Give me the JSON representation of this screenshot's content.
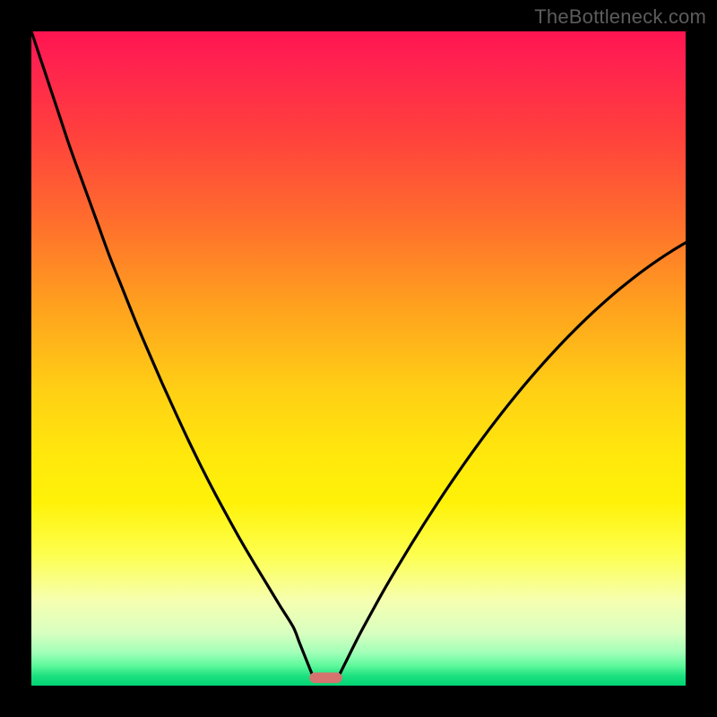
{
  "watermark": "TheBottleneck.com",
  "chart_data": {
    "type": "line",
    "title": "",
    "xlabel": "",
    "ylabel": "",
    "xlim": [
      0,
      100
    ],
    "ylim": [
      0,
      100
    ],
    "gradient_stops": [
      {
        "pct": 0,
        "color": "#ff1450"
      },
      {
        "pct": 4,
        "color": "#ff2050"
      },
      {
        "pct": 15,
        "color": "#ff3e3e"
      },
      {
        "pct": 28,
        "color": "#ff6a2e"
      },
      {
        "pct": 42,
        "color": "#ffa11e"
      },
      {
        "pct": 55,
        "color": "#ffd014"
      },
      {
        "pct": 65,
        "color": "#ffe80c"
      },
      {
        "pct": 72,
        "color": "#fff208"
      },
      {
        "pct": 80,
        "color": "#fdff4f"
      },
      {
        "pct": 87,
        "color": "#f6ffb0"
      },
      {
        "pct": 92,
        "color": "#d8ffc0"
      },
      {
        "pct": 95,
        "color": "#a0ffb8"
      },
      {
        "pct": 97,
        "color": "#5cf89a"
      },
      {
        "pct": 98.5,
        "color": "#1de080"
      },
      {
        "pct": 100,
        "color": "#00d474"
      }
    ],
    "series": [
      {
        "name": "left-branch",
        "x": [
          0,
          2,
          4,
          6,
          8,
          10,
          12,
          14,
          16,
          18,
          20,
          22,
          24,
          26,
          28,
          30,
          32,
          34,
          36,
          38,
          40,
          41,
          42,
          43
        ],
        "y": [
          100,
          94,
          88,
          82,
          76.5,
          71,
          65.5,
          60.5,
          55.5,
          50.8,
          46.2,
          41.8,
          37.5,
          33.4,
          29.5,
          25.8,
          22.2,
          18.8,
          15.5,
          12.2,
          9,
          6.5,
          4,
          1.5
        ]
      },
      {
        "name": "right-branch",
        "x": [
          47,
          48,
          50,
          52,
          54,
          56,
          58,
          60,
          62,
          64,
          66,
          68,
          70,
          72,
          74,
          76,
          78,
          80,
          82,
          84,
          86,
          88,
          90,
          92,
          94,
          96,
          98,
          100
        ],
        "y": [
          1.5,
          3.5,
          7.5,
          11.2,
          14.8,
          18.2,
          21.5,
          24.7,
          27.8,
          30.8,
          33.7,
          36.5,
          39.2,
          41.8,
          44.3,
          46.7,
          49,
          51.2,
          53.3,
          55.3,
          57.2,
          59,
          60.7,
          62.3,
          63.8,
          65.2,
          66.5,
          67.7
        ]
      }
    ],
    "marker": {
      "name": "bottom-pill",
      "x": 45,
      "y": 1.2,
      "width": 5,
      "height": 1.6,
      "color": "#d6736f"
    }
  }
}
